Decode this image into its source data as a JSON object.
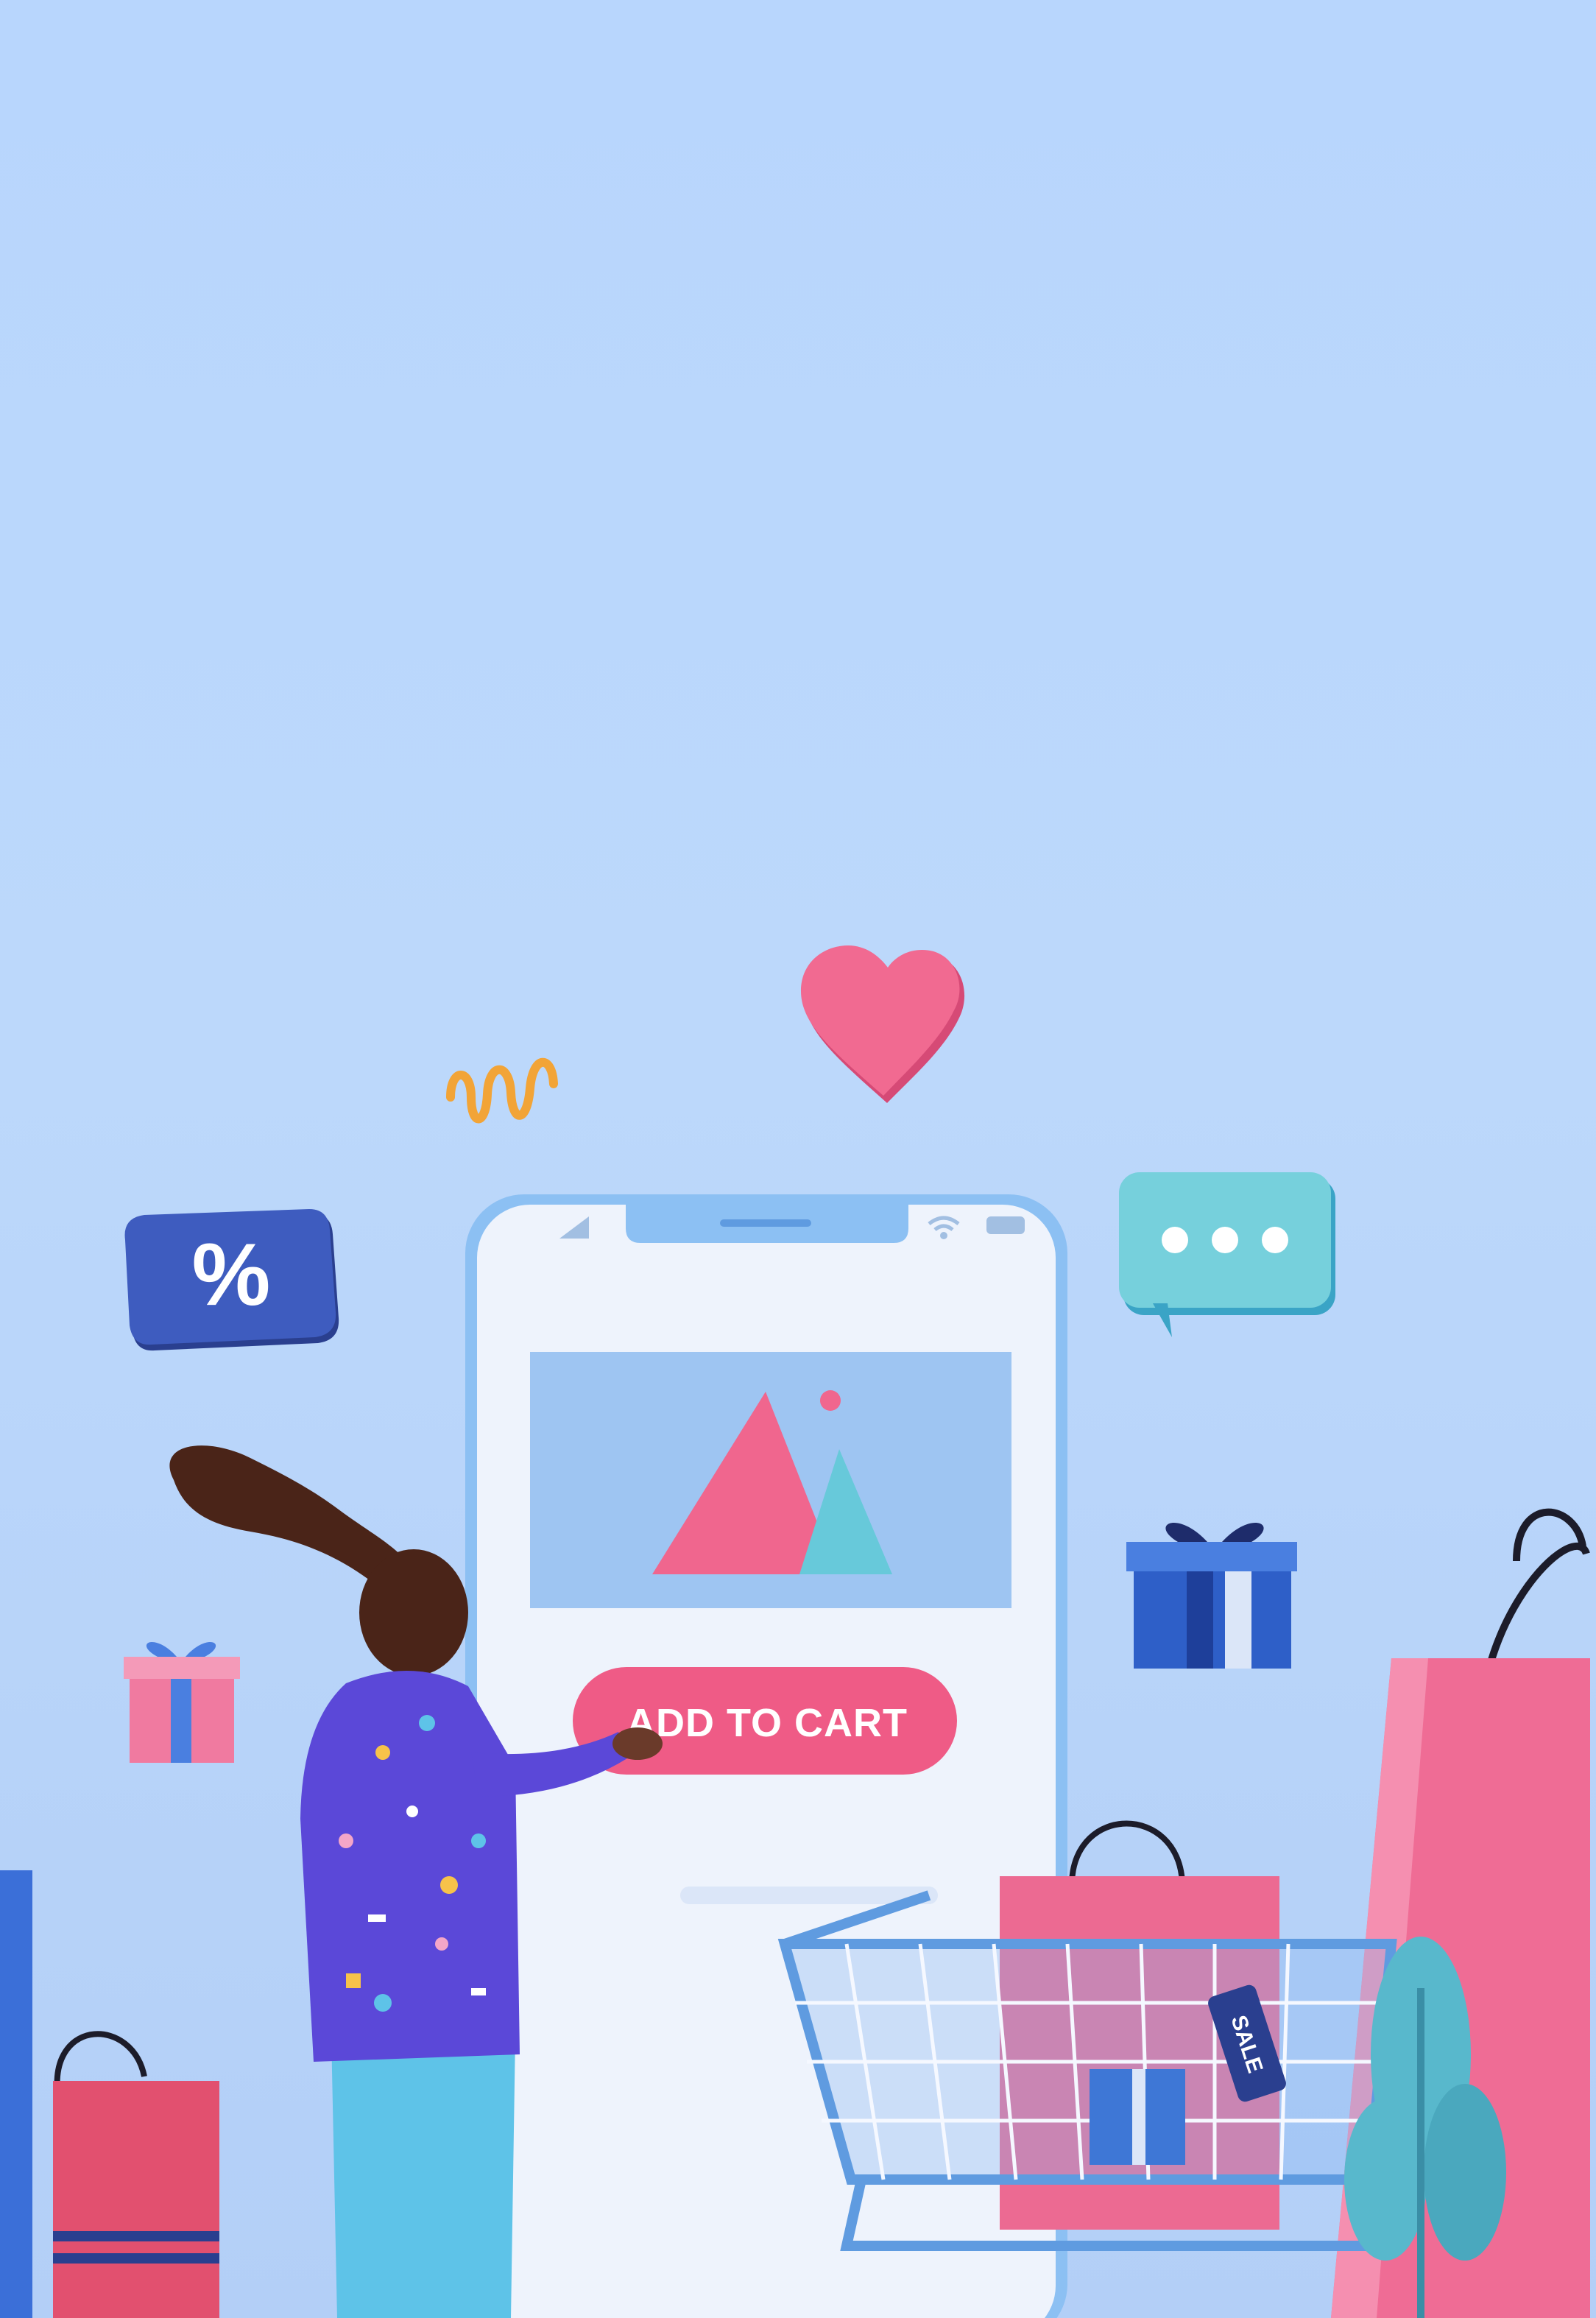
{
  "phone": {
    "cta_label": "ADD TO CART"
  },
  "badges": {
    "discount_symbol": "%",
    "sale_tag_text": "SALE"
  },
  "colors": {
    "background": "#b8d6fd",
    "accent_pink": "#ef5b86",
    "accent_blue": "#3e5cbf",
    "teal": "#67c9da",
    "phone_body": "#eef3fc"
  },
  "icons": [
    "heart-icon",
    "spring-icon",
    "percent-badge-icon",
    "chat-bubble-icon",
    "gift-icon",
    "signal-icon",
    "wifi-icon",
    "battery-icon",
    "image-placeholder-icon"
  ]
}
